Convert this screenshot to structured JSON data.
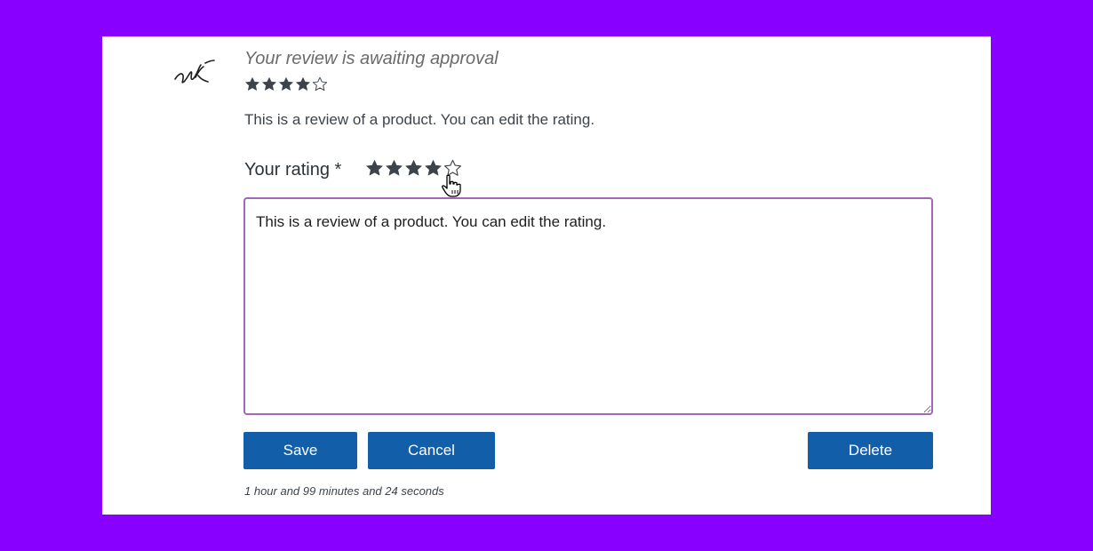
{
  "review": {
    "status": "Your review is awaiting approval",
    "rating": 4,
    "max_rating": 5,
    "text": "This is a review of a product. You can edit the rating."
  },
  "form": {
    "rating_label": "Your rating *",
    "rating": 4,
    "max_rating": 5,
    "textarea_value": "This is a review of a product. You can edit the rating."
  },
  "actions": {
    "save_label": "Save",
    "cancel_label": "Cancel",
    "delete_label": "Delete"
  },
  "timestamp": "1 hour and 99 minutes and 24 seconds",
  "icons": {
    "avatar": "signature-avatar-icon",
    "star_filled": "star-filled-icon",
    "star_empty": "star-outline-icon",
    "cursor": "pointer-hand-cursor-icon"
  },
  "colors": {
    "background": "#8800ff",
    "button": "#135ea8",
    "textarea_border": "#a366b8",
    "star": "#3c434a"
  }
}
